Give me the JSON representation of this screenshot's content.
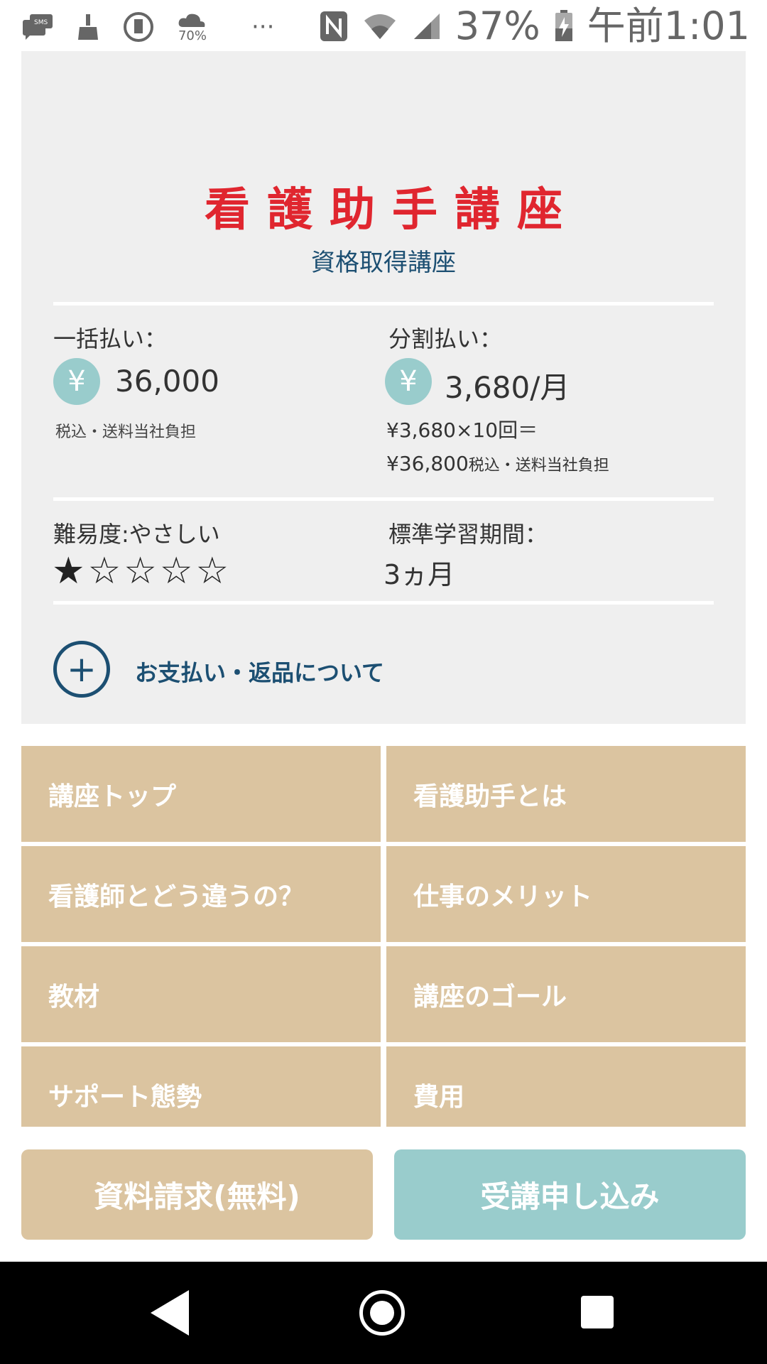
{
  "status_bar": {
    "icons_left": [
      "sms-icon",
      "cleaner-icon",
      "data-saver-icon",
      "weather-icon",
      "more-icon"
    ],
    "weather_text": "70%",
    "more_text": "···",
    "battery_percent": "37%",
    "time": "午前1:01",
    "icons_right": [
      "nfc-icon",
      "wifi-icon",
      "signal-icon",
      "battery-icon"
    ]
  },
  "course": {
    "title": "看護助手講座",
    "subtitle": "資格取得講座"
  },
  "payment": {
    "lump_label": "一括払い：",
    "lump_price": "36,000",
    "lump_note": "税込・送料当社負担",
    "split_label": "分割払い：",
    "split_price": "3,680/月",
    "split_formula": "¥3,680×10回＝",
    "split_total": "¥36,800",
    "split_note": "税込・送料当社負担",
    "yen_symbol": "¥"
  },
  "difficulty": {
    "label": "難易度:やさしい",
    "rating": 1,
    "max": 5,
    "stars_text": "★☆☆☆☆"
  },
  "study_period": {
    "label": "標準学習期間：",
    "value": "3ヵ月"
  },
  "payment_info_link": "お支払い・返品について",
  "nav_items": [
    {
      "label": "講座トップ"
    },
    {
      "label": "看護助手とは"
    },
    {
      "label": "看護師とどう違うの？"
    },
    {
      "label": "仕事のメリット"
    },
    {
      "label": "教材"
    },
    {
      "label": "講座のゴール"
    },
    {
      "label": "サポート態勢"
    },
    {
      "label": "費用"
    }
  ],
  "buttons": {
    "request": "資料請求(無料)",
    "apply": "受講申し込み"
  },
  "colors": {
    "title_red": "#e0262f",
    "navy": "#1c4f72",
    "tan": "#dbc4a0",
    "teal": "#99cccc",
    "card_bg": "#efefef"
  }
}
